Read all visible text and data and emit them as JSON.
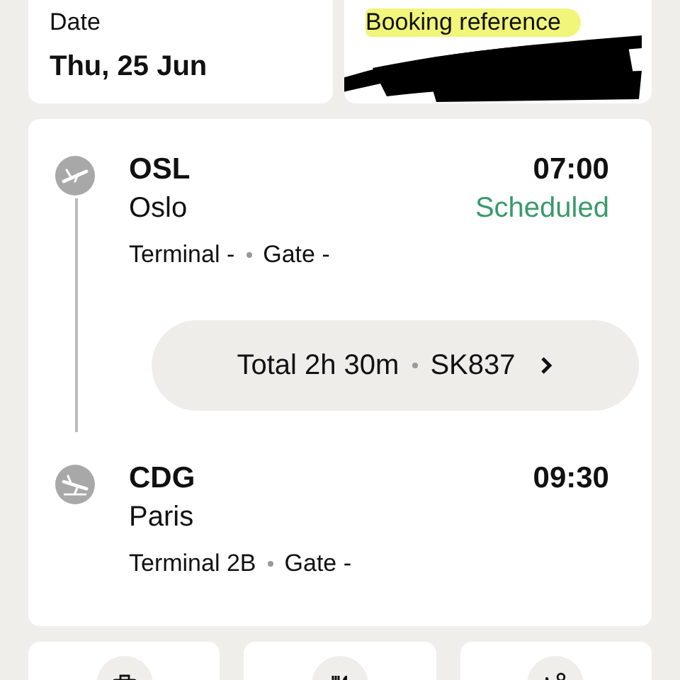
{
  "summary": [
    {
      "label": "Date",
      "value": "Thu, 25 Jun",
      "highlighted": false,
      "redacted": false
    },
    {
      "label": "Booking reference",
      "highlighted": true,
      "redacted": true
    }
  ],
  "flight": {
    "departure": {
      "kind": "takeoff",
      "code": "OSL",
      "city": "Oslo",
      "time": "07:00",
      "status": "Scheduled",
      "terminal": "Terminal -",
      "gate": "Gate -"
    },
    "duration_button": {
      "duration": "Total 2h 30m",
      "flight_number": "SK837"
    },
    "arrival": {
      "kind": "landing",
      "code": "CDG",
      "city": "Paris",
      "time": "09:30",
      "terminal": "Terminal 2B",
      "gate": "Gate -"
    }
  },
  "services": [
    {
      "kind": "baggage"
    },
    {
      "kind": "meal"
    },
    {
      "kind": "seat"
    }
  ]
}
